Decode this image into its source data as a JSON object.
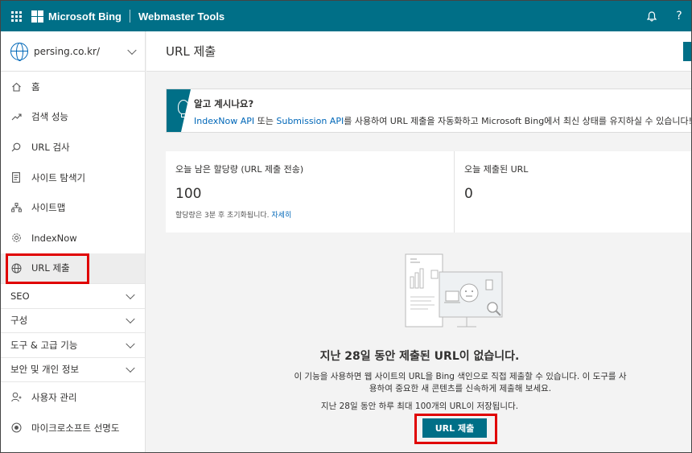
{
  "topbar": {
    "brand": "Microsoft Bing",
    "product": "Webmaster Tools",
    "notification_icon": "bell-icon",
    "help_label": "?"
  },
  "site": {
    "name": "persing.co.kr/"
  },
  "nav": {
    "items": [
      {
        "label": "홈",
        "icon": "home-icon"
      },
      {
        "label": "검색 성능",
        "icon": "trend-icon"
      },
      {
        "label": "URL 검사",
        "icon": "search-icon"
      },
      {
        "label": "사이트 탐색기",
        "icon": "document-icon"
      },
      {
        "label": "사이트맵",
        "icon": "sitemap-icon"
      },
      {
        "label": "IndexNow",
        "icon": "gear-icon"
      },
      {
        "label": "URL 제출",
        "icon": "globe-icon"
      }
    ],
    "groups": [
      {
        "label": "SEO"
      },
      {
        "label": "구성"
      },
      {
        "label": "도구 & 고급 기능"
      },
      {
        "label": "보안 및 개인 정보"
      }
    ],
    "bottom": [
      {
        "label": "사용자 관리",
        "icon": "user-icon"
      },
      {
        "label": "마이크로소프트 선명도",
        "icon": "clarity-icon"
      }
    ]
  },
  "main": {
    "title": "URL 제출",
    "banner": {
      "title": "알고 계시나요?",
      "link1": "IndexNow API",
      "text1": " 또는 ",
      "link2": "Submission API",
      "text2": "를 사용하여 URL 제출을 자동화하고 Microsoft Bing에서 최신 상태를 유지하실 수 있습니다!"
    },
    "quota": {
      "label": "오늘 남은 할당량 (URL 제출 전송)",
      "value": "100",
      "note": "할당량은 3분 후 초기화됩니다.",
      "note_link": "자세히"
    },
    "submitted": {
      "label": "오늘 제출된 URL",
      "value": "0"
    },
    "empty": {
      "title": "지난 28일 동안 제출된 URL이 없습니다.",
      "desc": "이 기능을 사용하면 웹 사이트의 URL을 Bing 색인으로 직접 제출할 수 있습니다. 이 도구를 사용하여 중요한 새 콘텐츠를 신속하게 제출해 보세요.",
      "limit": "지난 28일 동안 하루 최대 100개의 URL이 저장됩니다."
    },
    "submit_button": "URL 제출"
  },
  "colors": {
    "accent": "#006f87",
    "highlight": "#e00000",
    "link": "#0067b8"
  }
}
